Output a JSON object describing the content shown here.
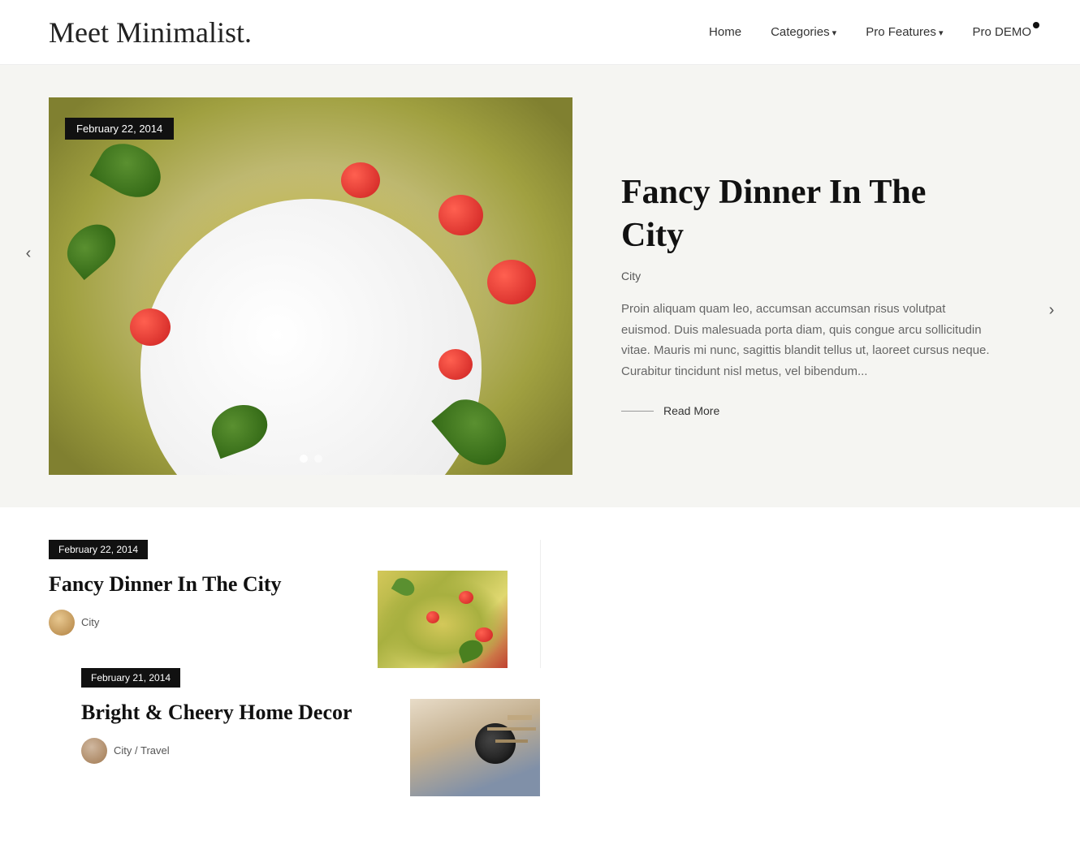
{
  "site": {
    "logo": "Meet Minimalist."
  },
  "nav": {
    "home": "Home",
    "categories": "Categories",
    "pro_features": "Pro Features",
    "pro_demo": "Pro DEMO"
  },
  "hero": {
    "date": "February 22, 2014",
    "title": "Fancy Dinner In The City",
    "category": "City",
    "excerpt": "Proin aliquam quam leo, accumsan accumsan risus volutpat euismod. Duis malesuada porta diam, quis congue arcu sollicitudin vitae. Mauris mi nunc, sagittis blandit tellus ut, laoreet cursus neque. Curabitur tincidunt nisl metus, vel bibendum...",
    "read_more": "Read More",
    "dot1_active": true,
    "dot2_active": false
  },
  "posts": [
    {
      "date": "February 22, 2014",
      "title": "Fancy Dinner In The City",
      "author": "City",
      "thumb_type": "pasta"
    },
    {
      "date": "February 21, 2014",
      "title": "Bright & Cheery Home Decor",
      "author": "City / Travel",
      "thumb_type": "home"
    }
  ]
}
